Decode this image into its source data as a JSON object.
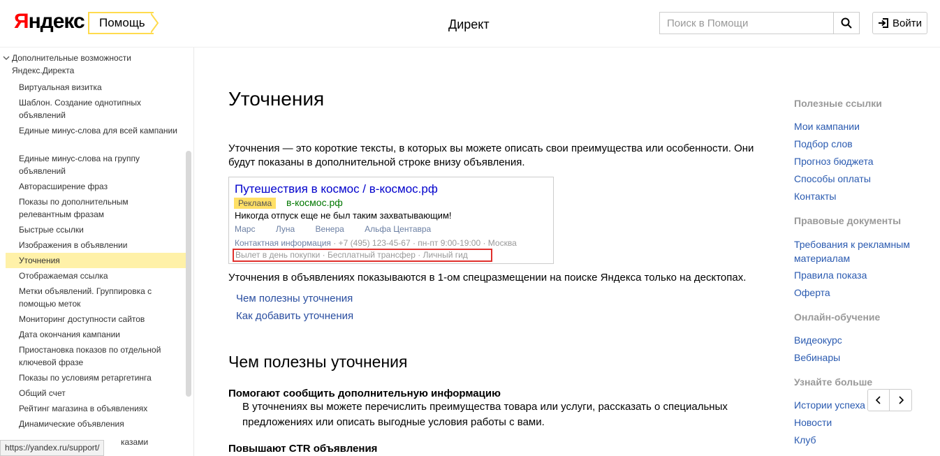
{
  "header": {
    "logo": "Яндекс",
    "logo_first": "Я",
    "logo_rest": "ндекс",
    "help_tag": "Помощь",
    "service": "Директ",
    "search_placeholder": "Поиск в Помощи",
    "login_label": "Войти"
  },
  "sidebar": {
    "group_label": "Дополнительные возможности Яндекс.Директа",
    "items": [
      {
        "label": "Виртуальная визитка"
      },
      {
        "label": "Шаблон. Создание однотипных объявлений"
      },
      {
        "label": "Единые минус-слова для всей кампании"
      },
      {
        "label": "Единые минус-слова на группу объявлений"
      },
      {
        "label": "Авторасширение фраз"
      },
      {
        "label": "Показы по дополнительным релевантным фразам"
      },
      {
        "label": "Быстрые ссылки"
      },
      {
        "label": "Изображения в объявлении"
      },
      {
        "label": "Уточнения"
      },
      {
        "label": "Отображаемая ссылка"
      },
      {
        "label": "Метки объявлений. Группировка с помощью меток"
      },
      {
        "label": "Мониторинг доступности сайтов"
      },
      {
        "label": "Дата окончания кампании"
      },
      {
        "label": "Приостановка показов по отдельной ключевой фразе"
      },
      {
        "label": "Показы по условиям ретаргетинга"
      },
      {
        "label": "Общий счет"
      },
      {
        "label": "Рейтинг магазина в объявлениях"
      },
      {
        "label": "Динамические объявления"
      },
      {
        "label": "казами"
      }
    ],
    "active_index": 8,
    "status_url": "https://yandex.ru/support/"
  },
  "main": {
    "title": "Уточнения",
    "intro": "Уточнения — это короткие тексты, в которых вы можете описать свои преимущества или особенности. Они будут показаны в дополнительной строке внизу объявления.",
    "ad": {
      "title": "Путешествия в космос / в-космос.рф",
      "badge": "Реклама",
      "domain": "в-космос.рф",
      "text": "Никогда отпуск еще не был таким захватывающим!",
      "sitelinks": [
        "Марс",
        "Луна",
        "Венера",
        "Альфа Центавра"
      ],
      "contact_link": "Контактная информация",
      "contact_rest": " · +7 (495) 123-45-67 · пн-пт 9:00-19:00 · Москва",
      "clarifications": "Вылет в день покупки · Бесплатный трансфер · Личный гид"
    },
    "placement_note": "Уточнения в объявлениях показываются в 1-ом спецразмещении на поиске Яндекса только на десктопах.",
    "toc": [
      "Чем полезны уточнения",
      "Как добавить уточнения"
    ],
    "section_title": "Чем полезны уточнения",
    "sub1_title": "Помогают сообщить дополнительную информацию",
    "sub1_text": "В уточнениях вы можете перечислить преимущества товара или услуги, рассказать о специальных предложениях или описать выгодные условия работы с вами.",
    "sub2_title": "Повышают CTR объявления"
  },
  "right": {
    "useful_head": "Полезные ссылки",
    "useful_links": [
      "Мои кампании",
      "Подбор слов",
      "Прогноз бюджета",
      "Способы оплаты",
      "Контакты"
    ],
    "legal_head": "Правовые документы",
    "legal_links": [
      "Требования к рекламным материалам",
      "Правила показа",
      "Оферта"
    ],
    "learn_head": "Онлайн-обучение",
    "learn_links": [
      "Видеокурс",
      "Вебинары"
    ],
    "more_head": "Узнайте больше",
    "more_links": [
      "Истории успеха",
      "Новости",
      "Клуб"
    ]
  },
  "colors": {
    "accent": "#ffdb4d",
    "link": "#2a5ab0",
    "active_bg": "#fff1a8",
    "highlight_border": "#e0302c"
  }
}
